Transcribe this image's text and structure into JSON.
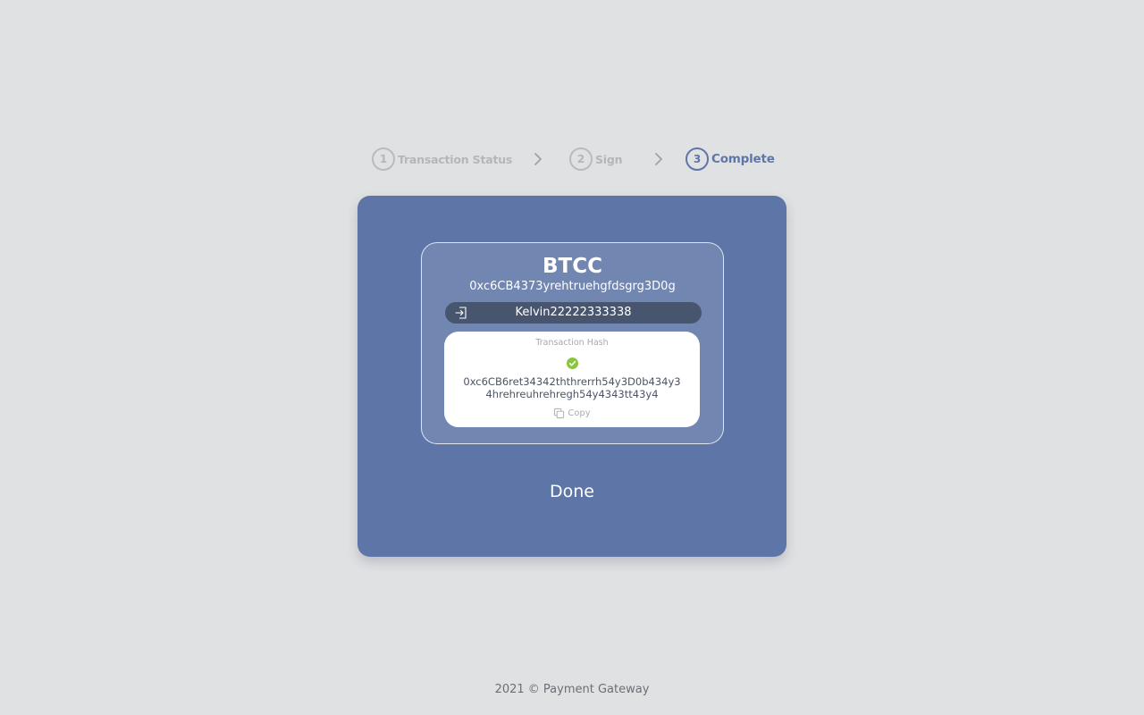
{
  "stepper": {
    "steps": [
      {
        "number": "1",
        "label": "Transaction Status",
        "state": "inactive"
      },
      {
        "number": "2",
        "label": "Sign",
        "state": "inactive"
      },
      {
        "number": "3",
        "label": "Complete",
        "state": "active"
      }
    ]
  },
  "card": {
    "coin": "BTCC",
    "address": "0xc6CB4373yrehtruehgfdsgrg3D0g",
    "username": "Kelvin22222333338",
    "hash_title": "Transaction Hash",
    "hash_value": "0xc6CB6ret34342ththrerrh54y3D0b434y34hrehreuhrehregh54y4343tt43y4",
    "copy_label": "Copy",
    "done_label": "Done"
  },
  "footer": {
    "text": "2021 © Payment Gateway"
  },
  "colors": {
    "background": "#e0e1e3",
    "card": "#5e76a7",
    "active_step": "#5e76a7",
    "inactive_step": "#b4b6ba",
    "success": "#8bc53f",
    "pill": "#48556f"
  },
  "icons": {
    "chevron": "chevron-right-icon",
    "pill": "login-icon",
    "status": "check-circle-icon",
    "copy": "copy-icon"
  }
}
